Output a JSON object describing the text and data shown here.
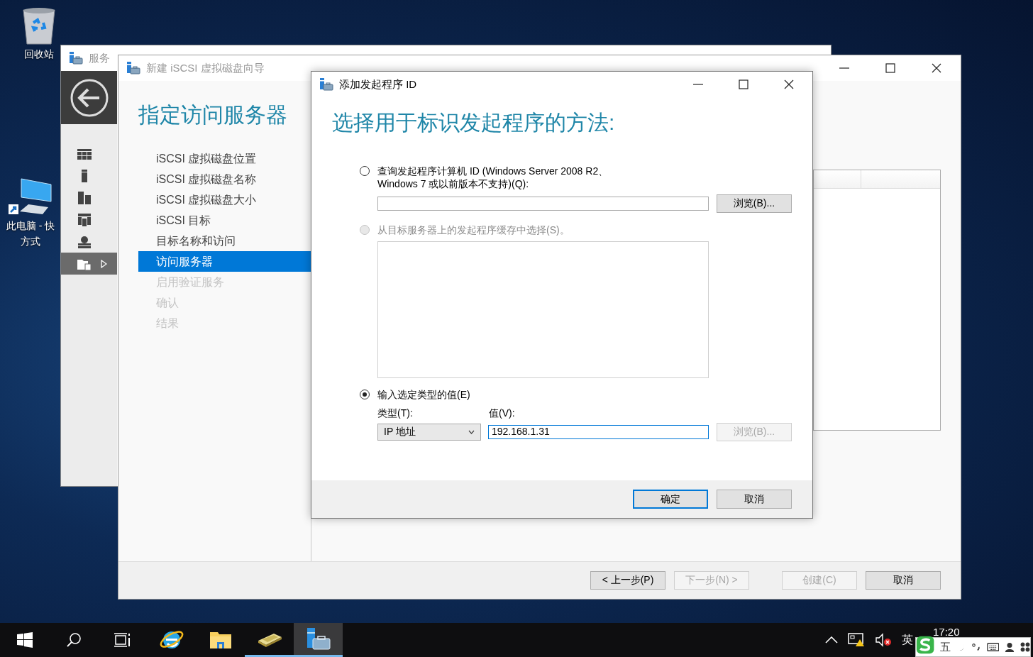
{
  "desktop_icons": [
    {
      "kind": "recycle-bin",
      "lines": [
        "回收站"
      ]
    },
    {
      "kind": "computer",
      "lines": [
        "此电脑 - 快",
        "方式"
      ]
    }
  ],
  "server_manager": {
    "title": "服务",
    "nav": [
      {
        "kind": "dashboard",
        "selected": false
      },
      {
        "kind": "server",
        "selected": false
      },
      {
        "kind": "servers",
        "selected": false
      },
      {
        "kind": "group",
        "selected": false
      },
      {
        "kind": "role",
        "selected": false
      },
      {
        "kind": "storage",
        "selected": true
      }
    ]
  },
  "wizard": {
    "title": "新建 iSCSI 虚拟磁盘向导",
    "heading": "指定访问服务器",
    "steps": [
      {
        "label": "iSCSI 虚拟磁盘位置",
        "selected": false,
        "disabled": false
      },
      {
        "label": "iSCSI 虚拟磁盘名称",
        "selected": false,
        "disabled": false
      },
      {
        "label": "iSCSI 虚拟磁盘大小",
        "selected": false,
        "disabled": false
      },
      {
        "label": "iSCSI 目标",
        "selected": false,
        "disabled": false
      },
      {
        "label": "目标名称和访问",
        "selected": false,
        "disabled": false
      },
      {
        "label": "访问服务器",
        "selected": true,
        "disabled": false
      },
      {
        "label": "启用验证服务",
        "selected": false,
        "disabled": true
      },
      {
        "label": "确认",
        "selected": false,
        "disabled": true
      },
      {
        "label": "结果",
        "selected": false,
        "disabled": true
      }
    ],
    "buttons": [
      {
        "label": "< 上一步(P)",
        "disabled": false
      },
      {
        "label": "下一步(N) >",
        "disabled": true
      },
      {
        "label": "创建(C)",
        "disabled": true
      },
      {
        "label": "取消",
        "disabled": false
      }
    ]
  },
  "dialog": {
    "title": "添加发起程序 ID",
    "heading": "选择用于标识发起程序的方法:",
    "options": [
      {
        "kind": "query",
        "label": "查询发起程序计算机 ID (Windows Server 2008 R2、\nWindows 7 或以前版本不支持)(Q):",
        "selected": false,
        "disabled": false,
        "browse": {
          "label": "浏览(B)...",
          "disabled": false
        }
      },
      {
        "kind": "cache",
        "label": "从目标服务器上的发起程序缓存中选择(S)。",
        "selected": false,
        "disabled": true
      },
      {
        "kind": "typed",
        "label": "输入选定类型的值(E)",
        "selected": true,
        "disabled": false,
        "type_label": "类型(T):",
        "type_value": "IP 地址",
        "value_label": "值(V):",
        "value": "192.168.1.31",
        "browse": {
          "label": "浏览(B)...",
          "disabled": true
        }
      }
    ],
    "buttons": [
      {
        "label": "确定",
        "default": true
      },
      {
        "label": "取消",
        "default": false
      }
    ]
  },
  "taskbar": {
    "items": [
      {
        "kind": "start",
        "running": false,
        "active": false
      },
      {
        "kind": "search",
        "running": false,
        "active": false
      },
      {
        "kind": "task-view",
        "running": false,
        "active": false
      },
      {
        "kind": "ie",
        "running": false,
        "active": false
      },
      {
        "kind": "explorer",
        "running": false,
        "active": false
      },
      {
        "kind": "tool",
        "running": true,
        "active": false
      },
      {
        "kind": "server-manager",
        "running": true,
        "active": true
      }
    ],
    "tray": {
      "language": "英",
      "clock": "17:20"
    },
    "ime": {
      "mode": "五"
    }
  }
}
